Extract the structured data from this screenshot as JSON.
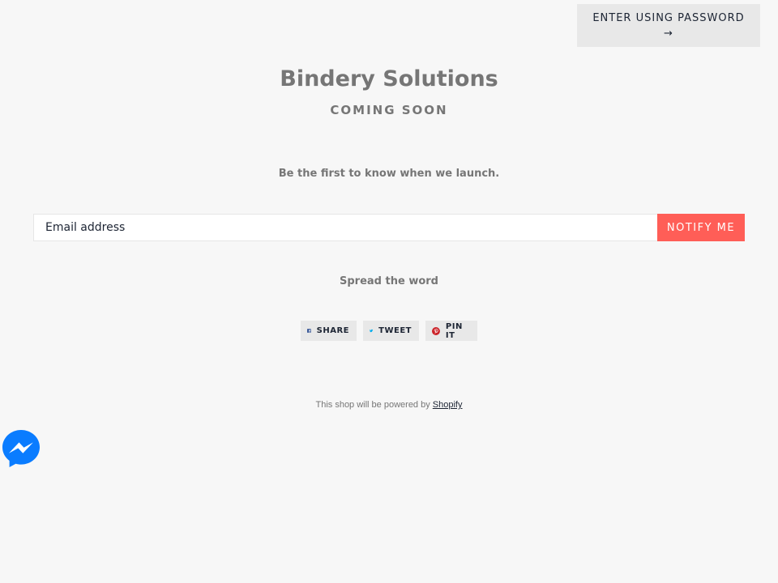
{
  "header": {
    "password_label": "ENTER USING PASSWORD",
    "password_arrow": "→"
  },
  "store": {
    "name": "Bindery Solutions",
    "status": "COMING SOON",
    "tagline": "Be the first to know when we launch."
  },
  "signup": {
    "email_placeholder": "Email address",
    "notify_label": "NOTIFY ME"
  },
  "social": {
    "heading": "Spread the word",
    "buttons": [
      {
        "label": "SHARE",
        "icon": "facebook-icon",
        "color": "#3b5998"
      },
      {
        "label": "TWEET",
        "icon": "twitter-icon",
        "color": "#00aced"
      },
      {
        "label": "PIN IT",
        "icon": "pinterest-icon",
        "color": "#cb2127"
      }
    ]
  },
  "footer": {
    "powered_text": "This shop will be powered by",
    "powered_link": "Shopify"
  },
  "colors": {
    "background": "#f7f7f7",
    "accent": "#ff5e57",
    "text": "#767676",
    "messenger": "#0a7cff"
  },
  "widget": {
    "icon": "messenger-icon"
  }
}
